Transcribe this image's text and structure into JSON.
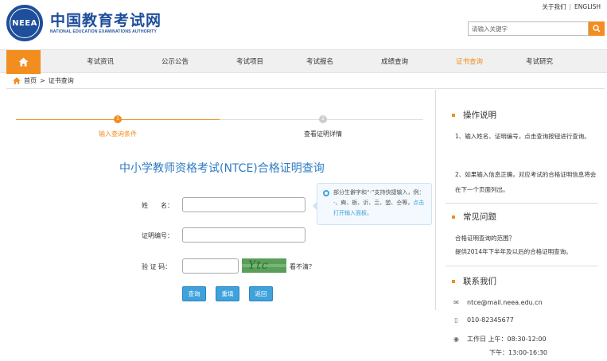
{
  "header": {
    "logo_mark": "NEEA",
    "logo_title": "中国教育考试网",
    "logo_subtitle": "NATIONAL EDUCATION EXAMINATIONS AUTHORITY",
    "about_link": "关于我们",
    "separator": "|",
    "english_link": "ENGLISH",
    "search_placeholder": "请输入关键字"
  },
  "nav": {
    "items": [
      {
        "label": "考试资讯"
      },
      {
        "label": "公示公告"
      },
      {
        "label": "考试项目"
      },
      {
        "label": "考试报名"
      },
      {
        "label": "成绩查询"
      },
      {
        "label": "证书查询"
      },
      {
        "label": "考试研究"
      }
    ],
    "active_index": 5
  },
  "breadcrumb": {
    "home": "首页",
    "separator": ">",
    "current": "证书查询"
  },
  "steps": [
    {
      "number": "1",
      "label": "输入查询条件"
    },
    {
      "number": "2",
      "label": "查看证明详情"
    }
  ],
  "form": {
    "title": "中小学教师资格考试(NTCE)合格证明查询",
    "name_label": "姓　　名：",
    "cert_label": "证明编号：",
    "captcha_label": "验 证 码：",
    "captcha_text": "Ytc",
    "unclear_label": "看不清？",
    "tooltip_text": "部分生僻字和“·”支持快捷输入，例：·、奭、栃、䜣、亖、堃、仝等，",
    "tooltip_link": "点击打开输入面板。",
    "buttons": {
      "query": "查询",
      "reset": "重填",
      "back": "返回"
    }
  },
  "sidebar": {
    "instructions_title": "操作说明",
    "instructions": [
      "1、输入姓名、证明编号，点击查询按钮进行查询。",
      "2、如果输入信息正确，对应考试的合格证明信息将会在下一个页面列出。"
    ],
    "faq_title": "常见问题",
    "faq_question": "合格证明查询的范围？",
    "faq_answer": "提供2014年下半年及以后的合格证明查询。",
    "contact_title": "联系我们",
    "email": "ntce@mail.neea.edu.cn",
    "phone": "010-82345677",
    "hours_am": "工作日 上午：08:30-12:00",
    "hours_pm": "下午：13:00-16:30"
  },
  "colors": {
    "accent": "#f28d1f",
    "brand": "#1f4e9a",
    "link": "#2f7cc4",
    "button": "#3fa2dd"
  }
}
